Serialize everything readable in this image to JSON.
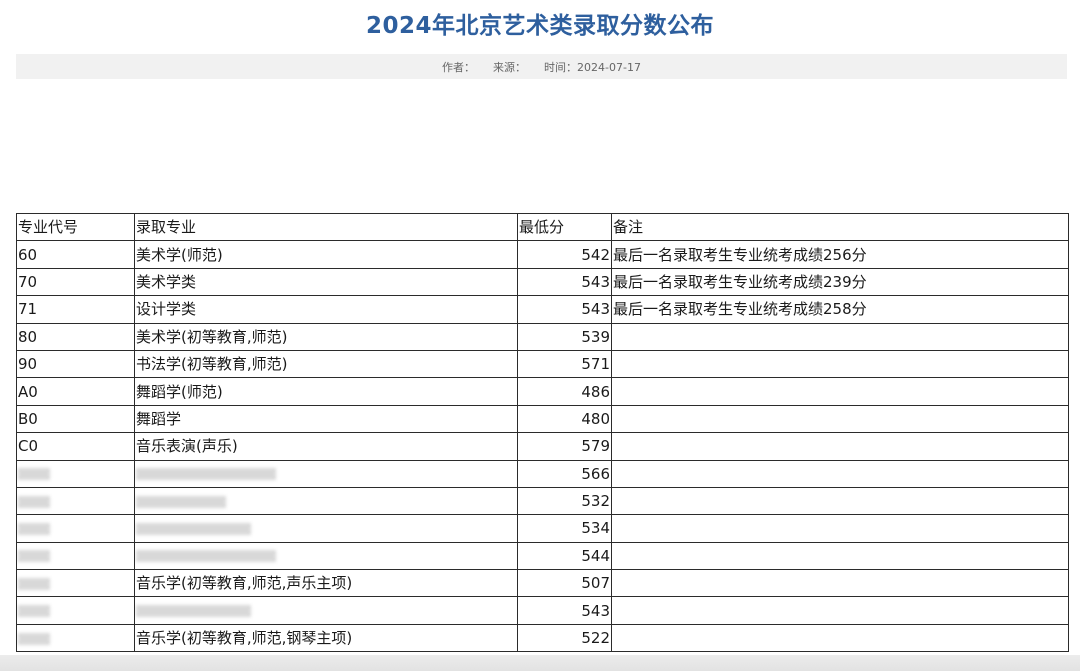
{
  "article": {
    "title": "2024年北京艺术类录取分数公布",
    "author_label": "作者：",
    "source_label": "来源：",
    "time_label": "时间：",
    "time_value": "2024-07-17"
  },
  "table": {
    "headers": [
      "专业代号",
      "录取专业",
      "最低分",
      "备注"
    ],
    "rows": [
      {
        "code": "60",
        "major": "美术学(师范)",
        "score": "542",
        "note": "最后一名录取考生专业统考成绩256分"
      },
      {
        "code": "70",
        "major": "美术学类",
        "score": "543",
        "note": "最后一名录取考生专业统考成绩239分"
      },
      {
        "code": "71",
        "major": "设计学类",
        "score": "543",
        "note": "最后一名录取考生专业统考成绩258分"
      },
      {
        "code": "80",
        "major": "美术学(初等教育,师范)",
        "score": "539",
        "note": ""
      },
      {
        "code": "90",
        "major": "书法学(初等教育,师范)",
        "score": "571",
        "note": ""
      },
      {
        "code": "A0",
        "major": "舞蹈学(师范)",
        "score": "486",
        "note": ""
      },
      {
        "code": "B0",
        "major": "舞蹈学",
        "score": "480",
        "note": ""
      },
      {
        "code": "C0",
        "major": "音乐表演(声乐)",
        "score": "579",
        "note": ""
      },
      {
        "code": "",
        "major": "",
        "score": "566",
        "note": ""
      },
      {
        "code": "",
        "major": "",
        "score": "532",
        "note": ""
      },
      {
        "code": "",
        "major": "",
        "score": "534",
        "note": ""
      },
      {
        "code": "",
        "major": "",
        "score": "544",
        "note": ""
      },
      {
        "code": "",
        "major": "音乐学(初等教育,师范,声乐主项)",
        "score": "507",
        "note": ""
      },
      {
        "code": "",
        "major": "",
        "score": "543",
        "note": ""
      },
      {
        "code": "",
        "major": "音乐学(初等教育,师范,钢琴主项)",
        "score": "522",
        "note": ""
      }
    ]
  }
}
